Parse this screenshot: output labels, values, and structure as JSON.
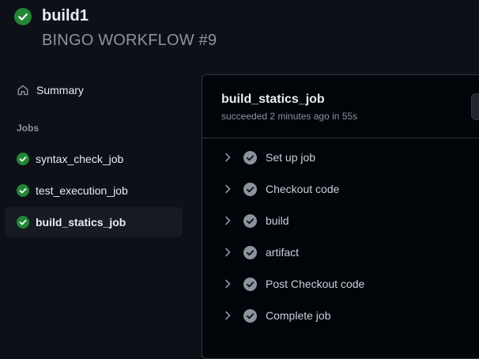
{
  "run": {
    "title": "build1",
    "subtitle": "BINGO WORKFLOW #9",
    "status_icon": "check-circle-fill-icon",
    "status_color": "#238636"
  },
  "sidebar": {
    "summary_label": "Summary",
    "summary_icon": "home-icon",
    "jobs_heading": "Jobs",
    "jobs": [
      {
        "label": "syntax_check_job",
        "status": "success"
      },
      {
        "label": "test_execution_job",
        "status": "success"
      },
      {
        "label": "build_statics_job",
        "status": "success",
        "selected": true
      }
    ]
  },
  "job_panel": {
    "title": "build_statics_job",
    "status_text": "succeeded 2 minutes ago in 55s",
    "steps": [
      {
        "label": "Set up job"
      },
      {
        "label": "Checkout code"
      },
      {
        "label": "build"
      },
      {
        "label": "artifact"
      },
      {
        "label": "Post Checkout code"
      },
      {
        "label": "Complete job"
      }
    ]
  },
  "colors": {
    "background": "#0d1117",
    "success": "#238636",
    "muted": "#8b949e",
    "step_check": "#8b949e"
  }
}
